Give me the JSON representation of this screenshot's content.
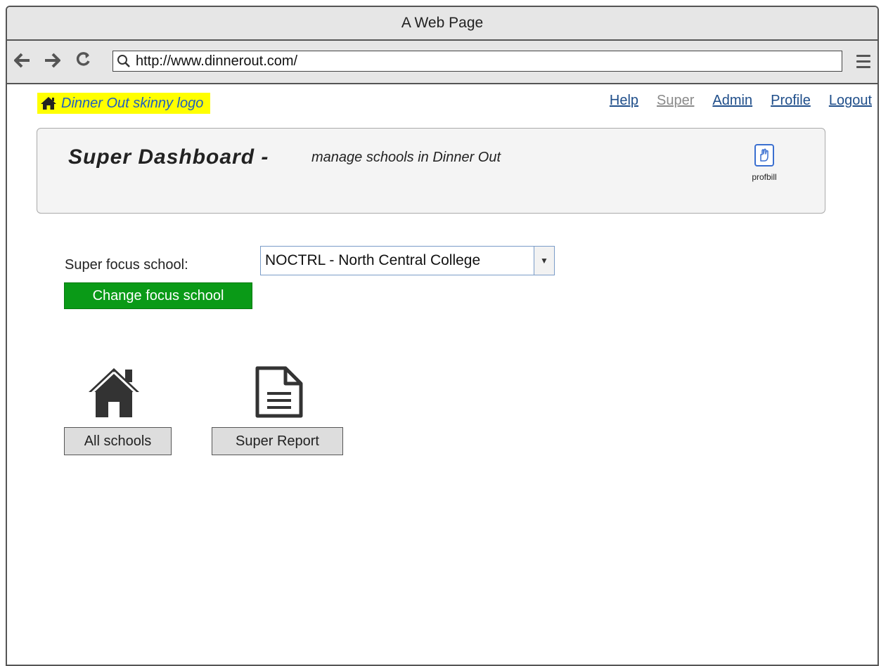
{
  "window": {
    "title": "A Web Page"
  },
  "toolbar": {
    "back_icon": "arrow-left-icon",
    "forward_icon": "arrow-right-icon",
    "reload_icon": "reload-icon",
    "url": "http://www.dinnerout.com/",
    "menu_icon": "hamburger-menu-icon"
  },
  "header": {
    "logo_text": "Dinner Out skinny logo",
    "logo_bg": "#ffff00",
    "links": [
      {
        "label": "Help",
        "current": false
      },
      {
        "label": "Super",
        "current": true
      },
      {
        "label": "Admin",
        "current": false
      },
      {
        "label": "Profile",
        "current": false
      },
      {
        "label": "Logout",
        "current": false
      }
    ]
  },
  "dashboard": {
    "title": "Super Dashboard -",
    "subtitle": "manage schools in Dinner Out",
    "username": "profbill"
  },
  "focus": {
    "label": "Super focus school:",
    "selected": "NOCTRL - North Central College",
    "button": "Change focus school",
    "button_color": "#0a9a17"
  },
  "tiles": {
    "all_schools": "All schools",
    "super_report": "Super Report"
  }
}
